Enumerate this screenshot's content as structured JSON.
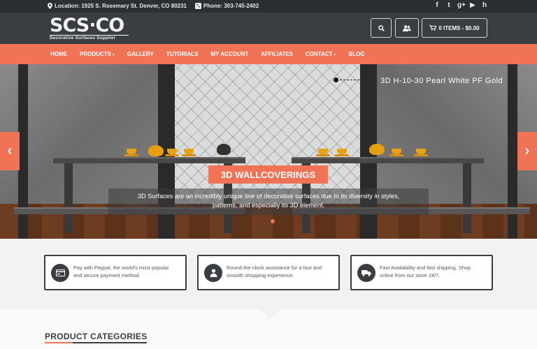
{
  "topbar": {
    "location_icon": "map-pin-icon",
    "location": "Location: 1925 S. Rosemary St. Denver, CO 80231",
    "phone_icon": "phone-icon",
    "phone": "Phone: 303-745-2402",
    "social": [
      {
        "name": "facebook-icon",
        "glyph": "f"
      },
      {
        "name": "twitter-icon",
        "glyph": "t"
      },
      {
        "name": "google-plus-icon",
        "glyph": "g+"
      },
      {
        "name": "youtube-icon",
        "glyph": "▶"
      },
      {
        "name": "houzz-icon",
        "glyph": "h"
      }
    ]
  },
  "header": {
    "logo_mark": "SCS·CO",
    "logo_tagline": "Decorative Surfaces Supplier",
    "search_icon": "search-icon",
    "users_icon": "users-icon",
    "cart_icon": "cart-icon",
    "cart_label": "0 ITEMS - $0.00"
  },
  "nav": {
    "items": [
      {
        "label": "HOME",
        "dropdown": false
      },
      {
        "label": "PRODUCTS",
        "dropdown": true
      },
      {
        "label": "GALLERY",
        "dropdown": false
      },
      {
        "label": "TUTORIALS",
        "dropdown": false
      },
      {
        "label": "MY ACCOUNT",
        "dropdown": false
      },
      {
        "label": "AFFILIATES",
        "dropdown": false
      },
      {
        "label": "CONTACT",
        "dropdown": true
      },
      {
        "label": "BLOG",
        "dropdown": false
      }
    ]
  },
  "hero": {
    "product_caption": "3D H-10-30 Pearl White PF Gold",
    "title": "3D WALLCOVERINGS",
    "text_line1": "3D Surfaces are an incredibly unique line of decorative surfaces due to its diversity in styles,",
    "text_line2": "patterns, and especially its 3D element.",
    "prev_glyph": "‹",
    "next_glyph": "›",
    "accent_color": "#f07356"
  },
  "features": [
    {
      "icon": "credit-card-icon",
      "glyph": "▭",
      "line1": "Pay with Paypal, the world's most popular",
      "line2": "and secure payment method."
    },
    {
      "icon": "user-icon",
      "glyph": "●",
      "line1": "Round-the-clock assistance for a fast and",
      "line2": "smooth shopping experience."
    },
    {
      "icon": "truck-icon",
      "glyph": "▣",
      "line1": "Fast Availability and fast shipping. Shop",
      "line2": "online from our store 24/7."
    }
  ],
  "categories": {
    "title": "PRODUCT CATEGORIES"
  },
  "colors": {
    "accent": "#f07356",
    "dark": "#3a3d42",
    "topbar": "#2b2e32"
  }
}
